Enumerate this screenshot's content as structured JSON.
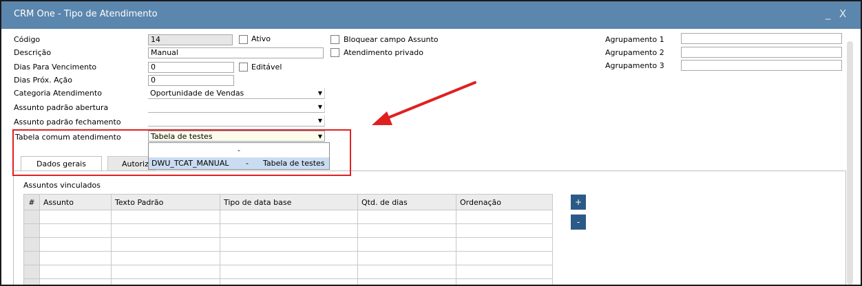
{
  "window": {
    "title": "CRM One - Tipo de Atendimento",
    "controls": [
      "_",
      "X"
    ]
  },
  "form": {
    "codigo": {
      "label": "Código",
      "value": "14"
    },
    "ativo": {
      "label": "Ativo"
    },
    "descricao": {
      "label": "Descrição",
      "value": "Manual"
    },
    "dias_vencimento": {
      "label": "Dias Para Vencimento",
      "value": "0"
    },
    "editavel": {
      "label": "Editável"
    },
    "dias_prox_acao": {
      "label": "Dias Próx. Ação",
      "value": "0"
    },
    "categoria": {
      "label": "Categoria Atendimento",
      "value": "Oportunidade de Vendas"
    },
    "assunto_abertura": {
      "label": "Assunto padrão abertura",
      "value": ""
    },
    "assunto_fechamento": {
      "label": "Assunto padrão fechamento",
      "value": ""
    },
    "tabela_comum": {
      "label": "Tabela comum atendimento",
      "value": "Tabela de testes"
    },
    "bloquear_assunto": {
      "label": "Bloquear campo Assunto"
    },
    "atendimento_privado": {
      "label": "Atendimento privado"
    },
    "agrupamento_1": {
      "label": "Agrupamento 1",
      "value": ""
    },
    "agrupamento_2": {
      "label": "Agrupamento 2",
      "value": ""
    },
    "agrupamento_3": {
      "label": "Agrupamento 3",
      "value": ""
    }
  },
  "dropdown": {
    "options": [
      {
        "code": "-",
        "desc": ""
      },
      {
        "code": "DWU_TCAT_MANUAL",
        "sep": "-",
        "desc": "Tabela de testes"
      }
    ]
  },
  "tabs": [
    {
      "label": "Dados gerais"
    },
    {
      "label": "Autoriz"
    }
  ],
  "section": {
    "title": "Assuntos vinculados"
  },
  "grid": {
    "columns": [
      "#",
      "Assunto",
      "Texto Padrão",
      "Tipo de data base",
      "Qtd. de dias",
      "Ordenação"
    ],
    "rows": 6
  },
  "buttons": {
    "add": "+",
    "remove": "-"
  },
  "colors": {
    "titlebar": "#5b86ad",
    "highlight": "#e02020",
    "button": "#2c5a86"
  }
}
